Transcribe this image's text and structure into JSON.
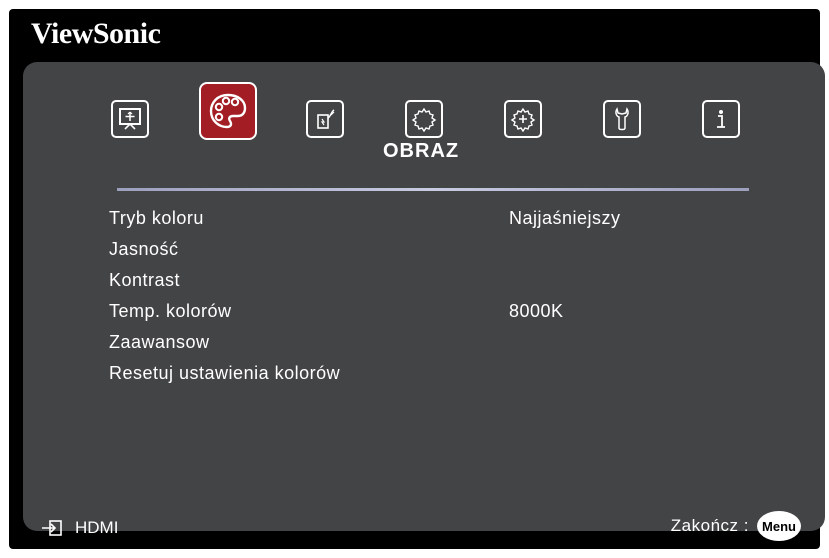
{
  "brand": "ViewSonic",
  "tabs": [
    {
      "icon": "display-icon"
    },
    {
      "icon": "palette-icon",
      "active": true
    },
    {
      "icon": "power-plug-icon"
    },
    {
      "icon": "settings-gear-icon"
    },
    {
      "icon": "advanced-settings-icon"
    },
    {
      "icon": "wrench-icon"
    },
    {
      "icon": "info-icon"
    }
  ],
  "section_title": "OBRAZ",
  "menu": [
    {
      "label": "Tryb koloru",
      "value": "Najjaśniejszy"
    },
    {
      "label": "Jasność",
      "value": ""
    },
    {
      "label": "Kontrast",
      "value": ""
    },
    {
      "label": "Temp. kolorów",
      "value": "8000K"
    },
    {
      "label": "Zaawansow",
      "value": ""
    },
    {
      "label": "Resetuj ustawienia kolorów",
      "value": ""
    }
  ],
  "footer": {
    "source": "HDMI",
    "exit_label": "Zakończ :",
    "menu_button": "Menu"
  },
  "colors": {
    "panel": "#434446",
    "active_tab": "#a31e24",
    "frame": "#000000"
  }
}
